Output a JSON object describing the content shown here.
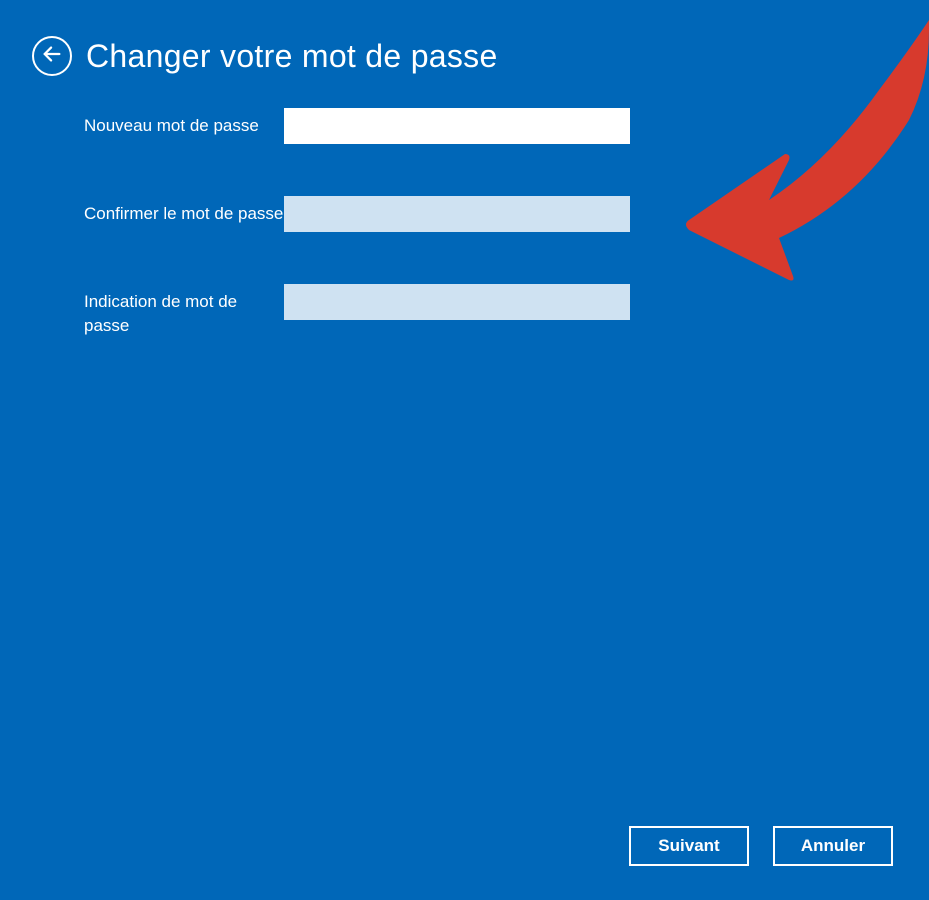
{
  "header": {
    "title": "Changer votre mot de passe"
  },
  "fields": {
    "new_password": {
      "label": "Nouveau mot de passe",
      "value": ""
    },
    "confirm_password": {
      "label": "Confirmer le mot de passe",
      "value": ""
    },
    "hint": {
      "label": "Indication de mot de passe",
      "value": ""
    }
  },
  "buttons": {
    "next": "Suivant",
    "cancel": "Annuler"
  },
  "colors": {
    "background": "#0067b8",
    "input_inactive": "#cfe2f2",
    "input_active": "#ffffff",
    "annotation_arrow": "#d73a2d"
  }
}
